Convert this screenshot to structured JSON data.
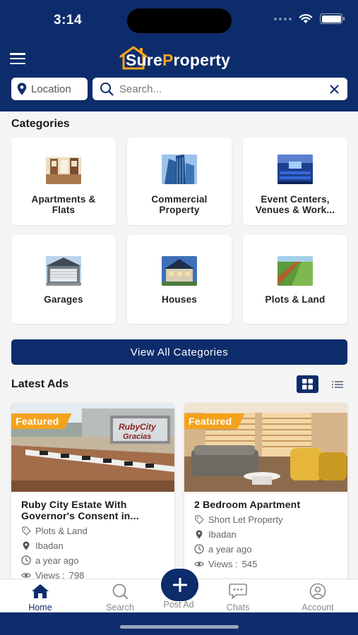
{
  "status_bar": {
    "time": "3:14"
  },
  "header": {
    "logo_prefix": "Sure",
    "logo_accent": "P",
    "logo_suffix": "roperty",
    "location_label": "Location",
    "search_placeholder": "Search...",
    "brand_color": "#0d2c6b",
    "accent_color": "#f5a51b"
  },
  "categories": {
    "title": "Categories",
    "items": [
      {
        "label": "Apartments &\nFlats",
        "icon": "apartment-photo"
      },
      {
        "label": "Commercial\nProperty",
        "icon": "commercial-photo"
      },
      {
        "label": "Event Centers,\nVenues & Work...",
        "icon": "event-center-photo"
      },
      {
        "label": "Garages",
        "icon": "garage-photo"
      },
      {
        "label": "Houses",
        "icon": "house-photo"
      },
      {
        "label": "Plots & Land",
        "icon": "land-photo"
      }
    ],
    "view_all_label": "View All Categories"
  },
  "latest_ads": {
    "title": "Latest Ads",
    "view_mode": "grid",
    "ads": [
      {
        "badge": "Featured",
        "title": "Ruby City Estate With Governor's Consent in...",
        "category": "Plots & Land",
        "location": "Ibadan",
        "time": "a year ago",
        "views_label": "Views :",
        "views": "798",
        "sign_text_1": "RubyCity",
        "sign_text_2": "Gracias"
      },
      {
        "badge": "Featured",
        "title": "2 Bedroom Apartment",
        "category": "Short Let Property",
        "location": "Ibadan",
        "time": "a year ago",
        "views_label": "Views :",
        "views": "545"
      }
    ]
  },
  "bottom_nav": {
    "items": [
      {
        "label": "Home",
        "icon": "home-icon",
        "active": true
      },
      {
        "label": "Search",
        "icon": "search-icon"
      },
      {
        "label": "Post Ad",
        "icon": "plus-icon"
      },
      {
        "label": "Chats",
        "icon": "chat-icon"
      },
      {
        "label": "Account",
        "icon": "account-icon"
      }
    ]
  }
}
